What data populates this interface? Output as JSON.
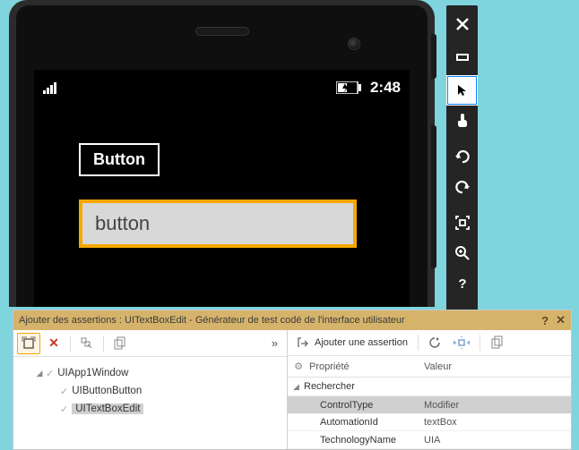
{
  "phone": {
    "clock": "2:48",
    "button_label": "Button",
    "textbox_value": "button"
  },
  "panel": {
    "title": "Ajouter des assertions : UITextBoxEdit - Générateur de test codé de l'interface utilisateur",
    "add_assertion_label": "Ajouter une assertion",
    "prop_col_property": "Propriété",
    "prop_col_value": "Valeur",
    "group_search": "Rechercher",
    "tree": {
      "root": "UIApp1Window",
      "child1": "UIButtonButton",
      "child2": "UITextBoxEdit"
    },
    "props": [
      {
        "name": "ControlType",
        "value": "Modifier"
      },
      {
        "name": "AutomationId",
        "value": "textBox"
      },
      {
        "name": "TechnologyName",
        "value": "UIA"
      }
    ]
  }
}
